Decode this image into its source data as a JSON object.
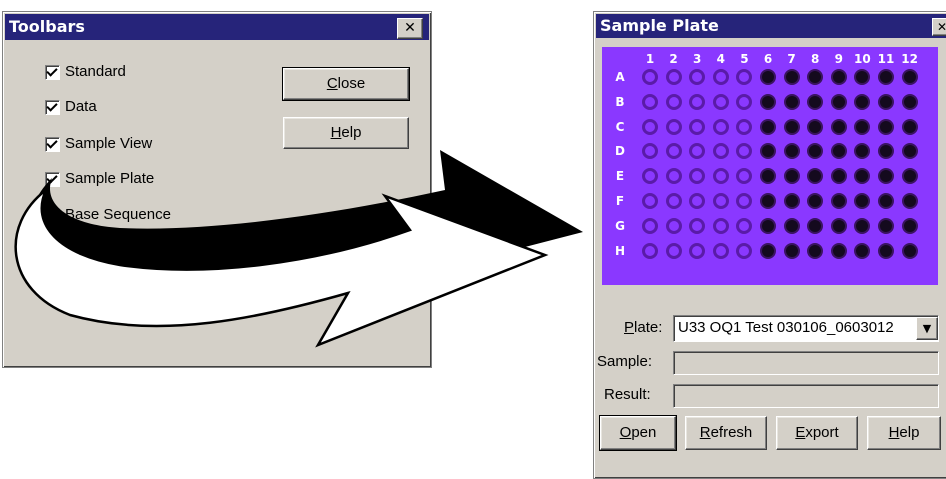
{
  "toolbars_dialog": {
    "title": "Toolbars",
    "close_x": "✕",
    "items": [
      {
        "label": "Standard",
        "checked": true
      },
      {
        "label": "Data",
        "checked": true
      },
      {
        "label": "Sample View",
        "checked": true
      },
      {
        "label": "Sample Plate",
        "checked": true
      },
      {
        "label": "Base Sequence",
        "checked": true
      }
    ],
    "close_button": {
      "accel": "C",
      "rest": "lose"
    },
    "help_button": {
      "accel": "H",
      "rest": "elp"
    }
  },
  "sample_plate": {
    "title": "Sample Plate",
    "close_x": "✕",
    "columns": [
      "1",
      "2",
      "3",
      "4",
      "5",
      "6",
      "7",
      "8",
      "9",
      "10",
      "11",
      "12"
    ],
    "rows": [
      "A",
      "B",
      "C",
      "D",
      "E",
      "F",
      "G",
      "H"
    ],
    "filled_from_column": 6,
    "plate_label": {
      "accel": "P",
      "rest": "late:"
    },
    "plate_value": "U33 OQ1 Test 030106_0603012",
    "sample_label": "Sample:",
    "result_label": "Result:",
    "buttons": [
      {
        "accel": "O",
        "rest": "pen"
      },
      {
        "accel": "R",
        "rest": "efresh"
      },
      {
        "accel": "E",
        "rest": "xport"
      },
      {
        "accel": "H",
        "rest": "elp"
      }
    ],
    "colors": {
      "plate_bg": "#8a38ff",
      "well_full": "#140a1e",
      "titlebar": "#26247a"
    }
  }
}
